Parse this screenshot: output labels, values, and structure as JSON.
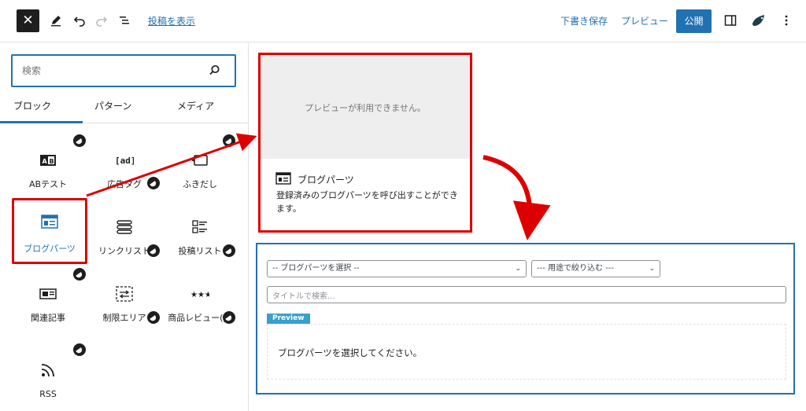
{
  "toolbar": {
    "close_glyph": "✕",
    "view_post_label": "投稿を表示",
    "save_draft_label": "下書き保存",
    "preview_label": "プレビュー",
    "publish_label": "公開"
  },
  "sidebar": {
    "search_placeholder": "検索",
    "tabs": [
      {
        "label": "ブロック",
        "active": true
      },
      {
        "label": "パターン",
        "active": false
      },
      {
        "label": "メディア",
        "active": false
      }
    ],
    "blocks": [
      {
        "label": "ABテスト",
        "icon": "ab-test-icon",
        "badge": true
      },
      {
        "label": "広告タグ",
        "icon": "ad-tag-icon",
        "badge": true
      },
      {
        "label": "ふきだし",
        "icon": "speech-bubble-icon",
        "badge": true
      },
      {
        "label": "ブログパーツ",
        "icon": "blog-parts-icon",
        "badge": false,
        "selected": true
      },
      {
        "label": "リンクリスト",
        "icon": "link-list-icon",
        "badge": true
      },
      {
        "label": "投稿リスト",
        "icon": "post-list-icon",
        "badge": true
      },
      {
        "label": "関連記事",
        "icon": "related-post-icon",
        "badge": true
      },
      {
        "label": "制限エリア",
        "icon": "restricted-area-icon",
        "badge": true
      },
      {
        "label": "商品レビュー(β)",
        "icon": "product-review-icon",
        "badge": true
      },
      {
        "label": "RSS",
        "icon": "rss-icon",
        "badge": true
      }
    ]
  },
  "popover": {
    "preview_unavailable": "プレビューが利用できません。",
    "title": "ブログパーツ",
    "description": "登録済みのブログパーツを呼び出すことができます。"
  },
  "editor_block": {
    "select_blog_parts": "-- ブログパーツを選択 --",
    "filter_by_use": "--- 用途で絞り込む ---",
    "title_search_placeholder": "タイトルで検索...",
    "preview_tag": "Preview",
    "placeholder_message": "ブログパーツを選択してください。"
  },
  "colors": {
    "accent": "#2271b1",
    "highlight": "#dd0000",
    "preview_tag": "#39a0cc"
  }
}
